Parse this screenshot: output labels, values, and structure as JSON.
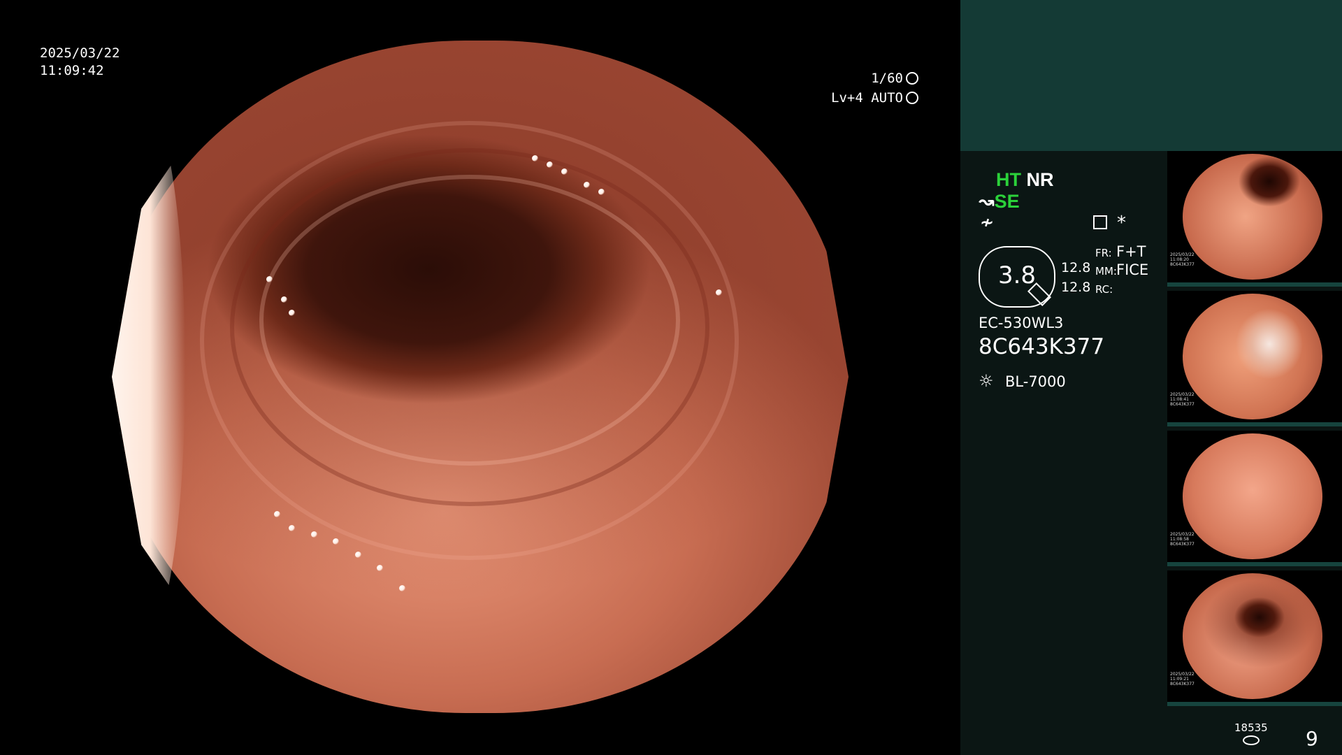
{
  "osd": {
    "date": "2025/03/22",
    "time": "11:09:42",
    "shutter": "1/60",
    "level": "Lv+4",
    "exposure_mode": "AUTO"
  },
  "panel": {
    "modes": {
      "ht": "HT",
      "nr": "NR",
      "se": "SE"
    },
    "zoom": "3.8",
    "fr_label": "FR:",
    "fr_value": "F+T",
    "mm_label": "MM:",
    "mm_value": "FICE",
    "rc_label": "RC:",
    "value_a": "12.8",
    "value_b": "12.8",
    "scope_model": "EC-530WL3",
    "scope_serial": "8C643K377",
    "light_source": "BL-7000",
    "storage_count": "18535",
    "page_number": "9"
  },
  "thumbnails": [
    {
      "id": "thumb-1",
      "caption_line1": "2025/03/22",
      "caption_line2": "11:08:20",
      "serial": "8C643K377"
    },
    {
      "id": "thumb-2",
      "caption_line1": "2025/03/22",
      "caption_line2": "11:08:41",
      "serial": "8C643K377"
    },
    {
      "id": "thumb-3",
      "caption_line1": "2025/03/22",
      "caption_line2": "11:08:58",
      "serial": "8C643K377"
    },
    {
      "id": "thumb-4",
      "caption_line1": "2025/03/22",
      "caption_line2": "11:09:21",
      "serial": "8C643K377"
    }
  ],
  "colors": {
    "accent_green": "#2bd13a",
    "panel_top": "#143a35",
    "panel_bg": "#0b1614"
  },
  "icons": [
    "shutter-icon",
    "auto-exposure-icon",
    "structure-enhance-icon",
    "freeze-icon",
    "settings-icon",
    "asterisk-icon",
    "magnifier-pen-icon",
    "light-source-icon",
    "storage-icon"
  ]
}
